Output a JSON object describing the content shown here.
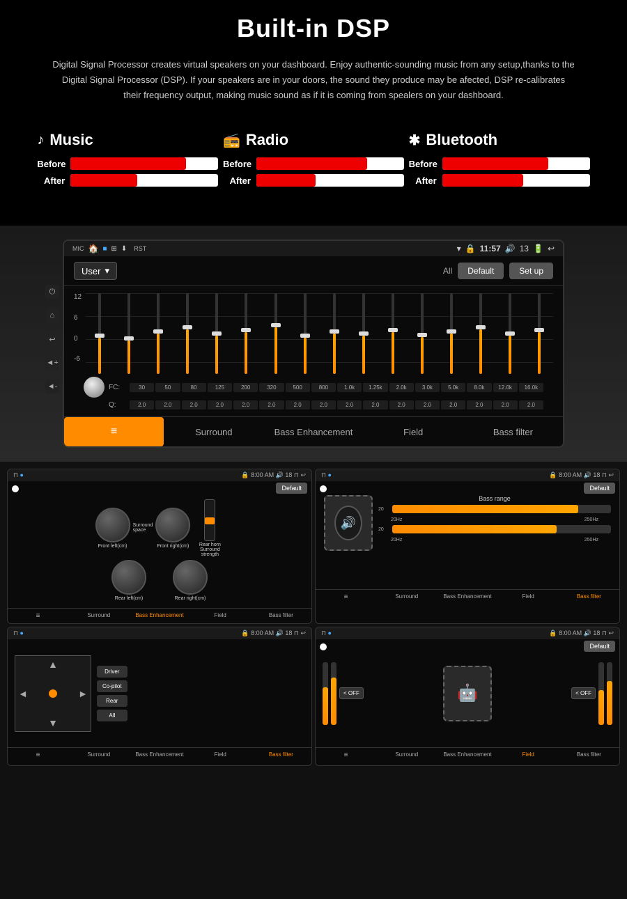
{
  "page": {
    "title": "Built-in DSP",
    "description": "Digital Signal Processor creates virtual speakers on your dashboard.\nEnjoy authentic-sounding music from any setup,thanks to the Digital Signal Processor (DSP). If your speakers are in your doors, the sound they produce may be afected, DSP re-calibrates their frequency output, making music sound as if it is coming from spealers on your dashboard."
  },
  "comparison": {
    "items": [
      {
        "icon": "♪",
        "label": "Music",
        "before_fill": "78%",
        "after_fill": "45%"
      },
      {
        "icon": "📻",
        "label": "Radio",
        "before_fill": "75%",
        "after_fill": "40%"
      },
      {
        "icon": "✱",
        "label": "Bluetooth",
        "before_fill": "72%",
        "after_fill": "55%"
      }
    ],
    "before_label": "Before",
    "after_label": "After"
  },
  "dsp_screen": {
    "status_bar": {
      "time": "11:57",
      "battery": "13",
      "mic": "MIC",
      "rst": "RST"
    },
    "controls": {
      "preset_label": "User",
      "all_label": "All",
      "default_btn": "Default",
      "setup_btn": "Set up"
    },
    "eq": {
      "labels": [
        "12",
        "6",
        "0",
        "-6"
      ],
      "freq_labels": [
        "30",
        "50",
        "80",
        "125",
        "200",
        "320",
        "500",
        "800",
        "1.0k",
        "1.25k",
        "2.0k",
        "3.0k",
        "5.0k",
        "8.0k",
        "12.0k",
        "16.0k"
      ],
      "q_label": "Q:",
      "q_values": [
        "2.0",
        "2.0",
        "2.0",
        "2.0",
        "2.0",
        "2.0",
        "2.0",
        "2.0",
        "2.0",
        "2.0",
        "2.0",
        "2.0",
        "2.0",
        "2.0",
        "2.0",
        "2.0"
      ],
      "fc_label": "FC:",
      "slider_heights": [
        45,
        42,
        50,
        55,
        48,
        52,
        58,
        45,
        50,
        48,
        52,
        46,
        50,
        55,
        48,
        52
      ],
      "thumb_positions": [
        50,
        55,
        48,
        45,
        52,
        48,
        42,
        55,
        50,
        52,
        48,
        54,
        50,
        45,
        52,
        48
      ]
    },
    "tabs": [
      {
        "label": "EQ",
        "icon": "≡",
        "active": true
      },
      {
        "label": "Surround",
        "active": false
      },
      {
        "label": "Bass Enhancement",
        "active": false
      },
      {
        "label": "Field",
        "active": false
      },
      {
        "label": "Bass filter",
        "active": false
      }
    ]
  },
  "screenshots": [
    {
      "id": "surround",
      "time": "8:00 AM",
      "battery": "18",
      "default_btn": "Default",
      "dials": [
        {
          "label": "Front left(cm)"
        },
        {
          "label": "Surround space"
        },
        {
          "label": "Front right(cm)"
        },
        {
          "label": "Rear horn\nSurround\nstrength"
        },
        {
          "label": "Rear left(cm)"
        },
        {
          "label": "Rear right(cm)"
        }
      ],
      "active_tab": "Bass Enhancement",
      "tabs": [
        "EQ",
        "Surround",
        "Bass Enhancement",
        "Field",
        "Bass filter"
      ]
    },
    {
      "id": "bass_enhancement",
      "time": "8:00 AM",
      "battery": "18",
      "default_btn": "Default",
      "title": "Bass range",
      "bar1_num": "20",
      "bar1_range": "20Hz - 250Hz",
      "bar2_num": "20",
      "bar2_range": "20Hz - 250Hz",
      "active_tab": "Bass filter",
      "tabs": [
        "EQ",
        "Surround",
        "Bass Enhancement",
        "Field",
        "Bass filter"
      ]
    },
    {
      "id": "field",
      "time": "8:00 AM",
      "battery": "18",
      "field_btns": [
        "Driver",
        "Co-pilot",
        "Rear",
        "All"
      ],
      "active_tab": "Bass filter",
      "tabs": [
        "EQ",
        "Surround",
        "Bass Enhancement",
        "Field",
        "Bass filter"
      ]
    },
    {
      "id": "bass_filter",
      "time": "8:00 AM",
      "battery": "18",
      "default_btn": "Default",
      "off_btn": "< OFF",
      "active_tab": "Field",
      "tabs": [
        "EQ",
        "Surround",
        "Bass Enhancement",
        "Field",
        "Bass filter"
      ]
    }
  ]
}
